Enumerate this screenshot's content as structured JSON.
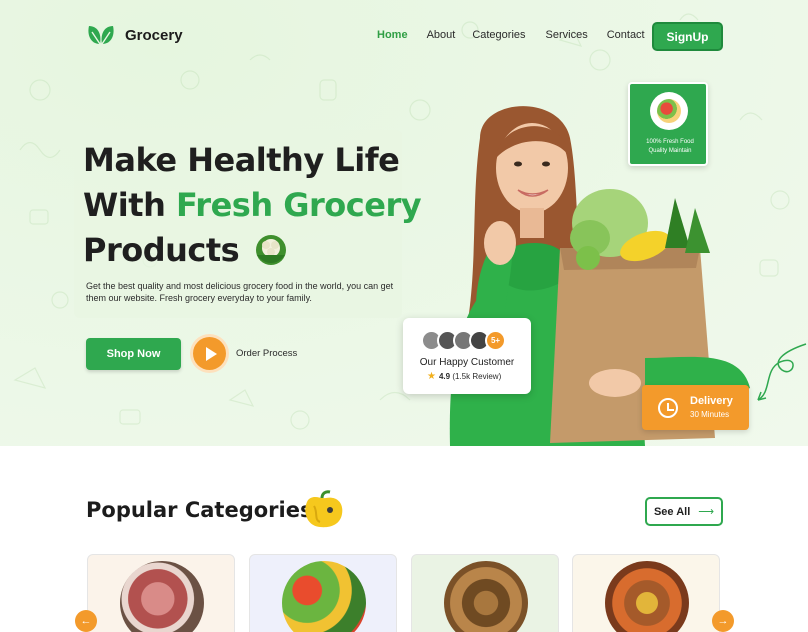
{
  "header": {
    "logo_text": "Grocery",
    "nav": [
      "Home",
      "About",
      "Categories",
      "Services",
      "Contact"
    ],
    "active_nav": "Home",
    "signup_label": "SignUp"
  },
  "hero": {
    "title_line1": "Make Healthy Life",
    "title_line2_prefix": "With ",
    "title_line2_highlight": "Fresh Grocery",
    "title_line3": "Products",
    "subtitle": "Get the best quality and most delicious grocery food in the world, you can get them our website. Fresh grocery everyday to your family.",
    "shop_label": "Shop Now",
    "order_label": "Order Process"
  },
  "badges": {
    "fresh_line1": "100% Fresh Food",
    "fresh_line2": "Quality Maintain",
    "happy_more": "5+",
    "happy_title": "Our Happy Customer",
    "rating": "4.9",
    "reviews": "(1.5k Review)",
    "delivery_title": "Delivery",
    "delivery_sub": "30 Minutes"
  },
  "categories": {
    "title": "Popular Categories",
    "see_all": "See All",
    "arrow_left": "←",
    "arrow_right": "→"
  },
  "colors": {
    "accent": "#2fa84f",
    "orange": "#f39a2b"
  }
}
